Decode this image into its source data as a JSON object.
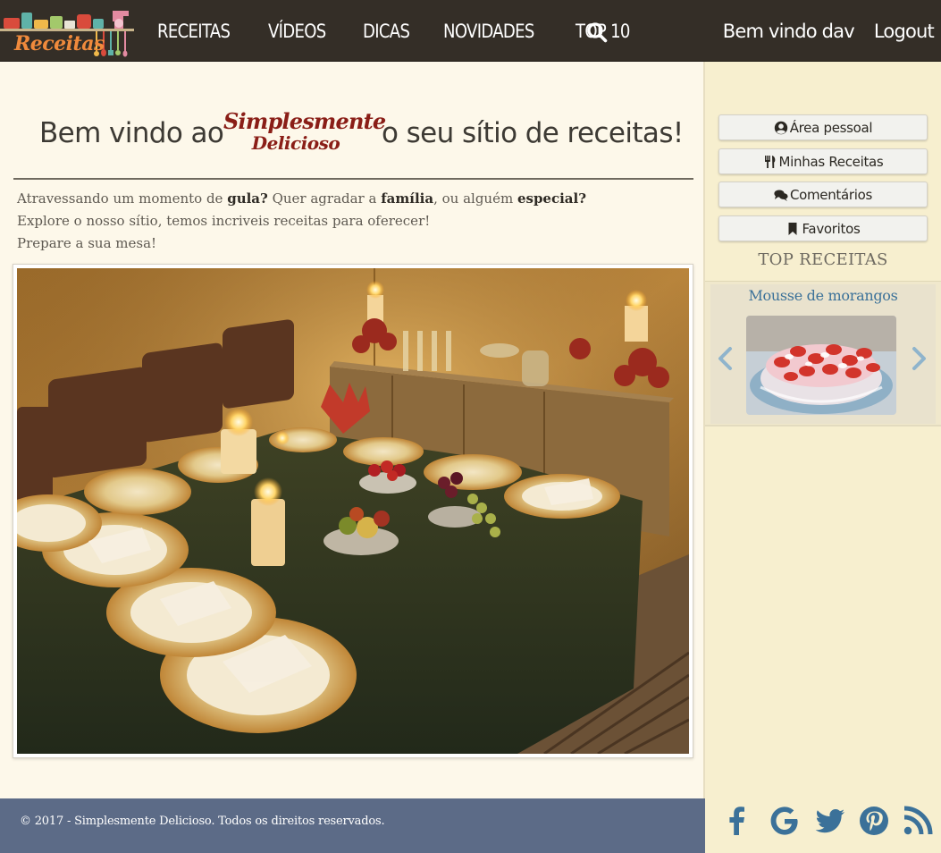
{
  "logo": {
    "word": "Receitas"
  },
  "nav": {
    "items": [
      {
        "label": "RECEITAS"
      },
      {
        "label": "VÍDEOS"
      },
      {
        "label": "DICAS"
      },
      {
        "label": "NOVIDADES"
      },
      {
        "label": "TOP 10"
      }
    ],
    "welcome": "Bem vindo dav",
    "logout": "Logout",
    "search_icon": "search-icon"
  },
  "hero": {
    "prefix": "Bem vindo ao",
    "brand_line1": "Simplesmente",
    "brand_line2": "Delicioso",
    "suffix": "o seu sítio de receitas!"
  },
  "intro": {
    "line1_a": "Atravessando um momento de ",
    "line1_b": "gula?",
    "line1_c": " Quer agradar a ",
    "line1_d": "família",
    "line1_e": ", ou alguém ",
    "line1_f": "especial?",
    "line2": "Explore o nosso sítio, temos incriveis receitas para oferecer!",
    "line3": "Prepare a sua mesa!"
  },
  "sidebar": {
    "buttons": [
      {
        "label": "Área pessoal",
        "icon": "user-circle-icon"
      },
      {
        "label": "Minhas Receitas",
        "icon": "cutlery-icon"
      },
      {
        "label": "Comentários",
        "icon": "comments-icon"
      },
      {
        "label": "Favoritos",
        "icon": "bookmark-icon"
      }
    ],
    "top_title": "TOP RECEITAS",
    "carousel": {
      "title": "Mousse de morangos"
    }
  },
  "footer": {
    "copyright": "© 2017 - Simplesmente Delicioso. Todos os direitos reservados."
  },
  "social": [
    "facebook-icon",
    "google-icon",
    "twitter-icon",
    "pinterest-icon",
    "rss-icon"
  ],
  "colors": {
    "navbar": "#342e27",
    "main_bg": "#fdf8ea",
    "sidebar_bg": "#f7efcf",
    "footer_bg": "#5c6b87",
    "social": "#3b7199",
    "brand": "#8a1e17"
  }
}
